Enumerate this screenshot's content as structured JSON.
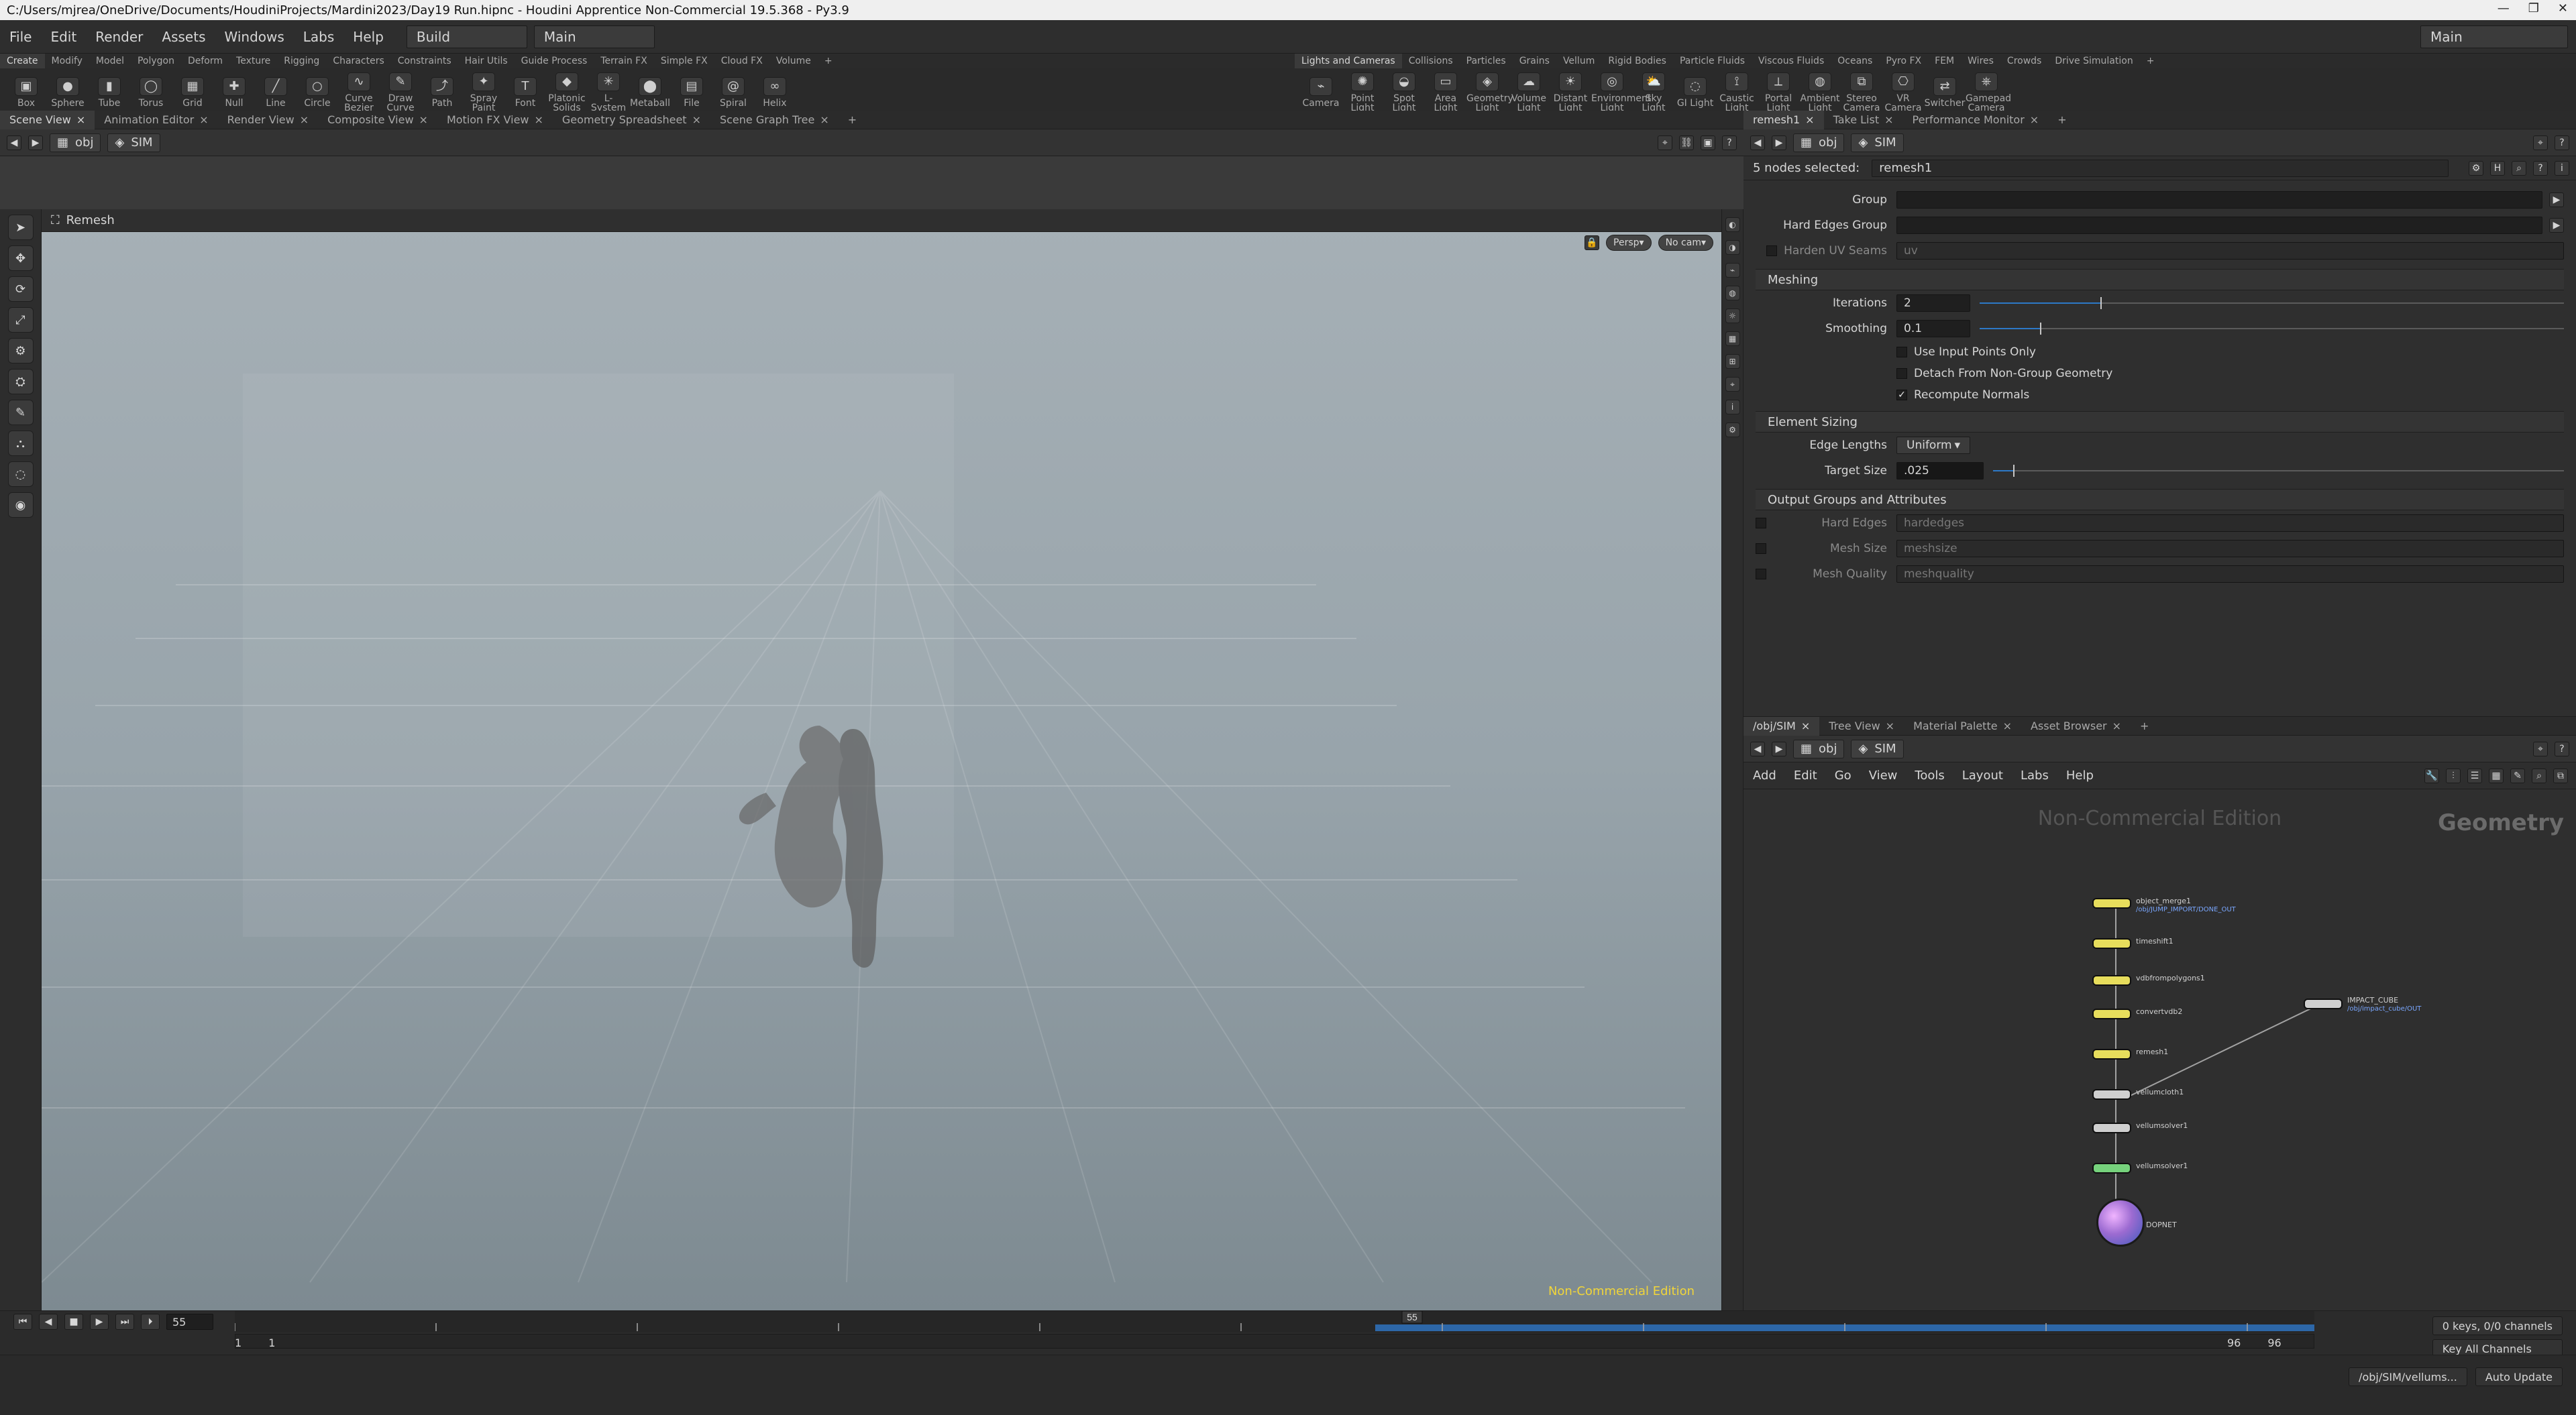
{
  "window": {
    "title": "C:/Users/mjrea/OneDrive/Documents/HoudiniProjects/Mardini2023/Day19 Run.hipnc - Houdini Apprentice Non-Commercial 19.5.368 - Py3.9"
  },
  "menubar": {
    "items": [
      "File",
      "Edit",
      "Render",
      "Assets",
      "Windows",
      "Labs",
      "Help"
    ],
    "desktop": "Build",
    "main": "Main",
    "right_main": "Main"
  },
  "shelf": {
    "tabs_left": [
      "Create",
      "Modify",
      "Model",
      "Polygon",
      "Deform",
      "Texture",
      "Rigging",
      "Characters",
      "Constraints",
      "Hair Utils",
      "Guide Process",
      "Terrain FX",
      "Simple FX",
      "Cloud FX",
      "Volume"
    ],
    "tools_left": [
      "Box",
      "Sphere",
      "Tube",
      "Torus",
      "Grid",
      "Null",
      "Line",
      "Circle",
      "Curve Bezier",
      "Draw Curve",
      "Path",
      "Spray Paint",
      "Font",
      "Platonic Solids",
      "L-System",
      "Metaball",
      "File",
      "Spiral",
      "Helix"
    ],
    "tabs_right": [
      "Lights and Cameras",
      "Collisions",
      "Particles",
      "Grains",
      "Vellum",
      "Rigid Bodies",
      "Particle Fluids",
      "Viscous Fluids",
      "Oceans",
      "Pyro FX",
      "FEM",
      "Wires",
      "Crowds",
      "Drive Simulation"
    ],
    "tools_right": [
      "Camera",
      "Point Light",
      "Spot Light",
      "Area Light",
      "Geometry Light",
      "Volume Light",
      "Distant Light",
      "Environment Light",
      "Sky Light",
      "GI Light",
      "Caustic Light",
      "Portal Light",
      "Ambient Light",
      "Stereo Camera",
      "VR Camera",
      "Switcher",
      "Gamepad Camera"
    ]
  },
  "left_tabs": [
    "Scene View",
    "Animation Editor",
    "Render View",
    "Composite View",
    "Motion FX View",
    "Geometry Spreadsheet",
    "Scene Graph Tree"
  ],
  "viewport": {
    "path_obj": "obj",
    "path_sim": "SIM",
    "node_title": "Remesh",
    "persp": "Persp",
    "cam": "No cam",
    "watermark": "Non-Commercial Edition"
  },
  "right_top_tabs": [
    "remesh1",
    "Take List",
    "Performance Monitor"
  ],
  "params": {
    "path_obj": "obj",
    "path_sim": "SIM",
    "nodes_selected": "5 nodes selected:",
    "node_name": "remesh1",
    "group_label": "Group",
    "hard_edges_group_label": "Hard Edges Group",
    "harden_uv_seams_label": "Harden UV Seams",
    "harden_uv_seams_value": "uv",
    "meshing_label": "Meshing",
    "iterations_label": "Iterations",
    "iterations_value": "2",
    "smoothing_label": "Smoothing",
    "smoothing_value": "0.1",
    "use_input_points_only": "Use Input Points Only",
    "detach_non_group": "Detach From Non-Group Geometry",
    "recompute_normals": "Recompute Normals",
    "element_sizing_label": "Element Sizing",
    "edge_lengths_label": "Edge Lengths",
    "edge_lengths_value": "Uniform",
    "target_size_label": "Target Size",
    "target_size_value": ".025",
    "output_groups_label": "Output Groups and Attributes",
    "hard_edges_label": "Hard Edges",
    "hard_edges_value": "hardedges",
    "mesh_size_label": "Mesh Size",
    "mesh_size_value": "meshsize",
    "mesh_quality_label": "Mesh Quality",
    "mesh_quality_value": "meshquality"
  },
  "network": {
    "tabs": [
      "/obj/SIM",
      "Tree View",
      "Material Palette",
      "Asset Browser"
    ],
    "path_obj": "obj",
    "path_sim": "SIM",
    "menu": [
      "Add",
      "Edit",
      "Go",
      "View",
      "Tools",
      "Layout",
      "Labs",
      "Help"
    ],
    "watermark": "Non-Commercial Edition",
    "context": "Geometry",
    "nodes": [
      {
        "name": "object_merge1",
        "sub": "/obj/JUMP_IMPORT/DONE_OUT"
      },
      {
        "name": "timeshift1",
        "sub": ""
      },
      {
        "name": "vdbfrompolygons1",
        "sub": ""
      },
      {
        "name": "convertvdb2",
        "sub": ""
      },
      {
        "name": "remesh1",
        "sub": ""
      },
      {
        "name": "vellumcloth1",
        "sub": ""
      },
      {
        "name": "vellumsolver1",
        "sub": ""
      },
      {
        "name": "vellumsolver1",
        "sub": ""
      },
      {
        "name": "DOPNET",
        "sub": ""
      },
      {
        "name": "IMPACT_CUBE",
        "sub": "/obj/impact_cube/OUT"
      }
    ]
  },
  "timeline": {
    "frame": "55",
    "start": "1",
    "start2": "1",
    "end": "96",
    "end2": "96",
    "current_marker": "55"
  },
  "status": {
    "keys": "0 keys, 0/0 channels",
    "key_all": "Key All Channels",
    "path": "/obj/SIM/vellums...",
    "auto_update": "Auto Update"
  }
}
